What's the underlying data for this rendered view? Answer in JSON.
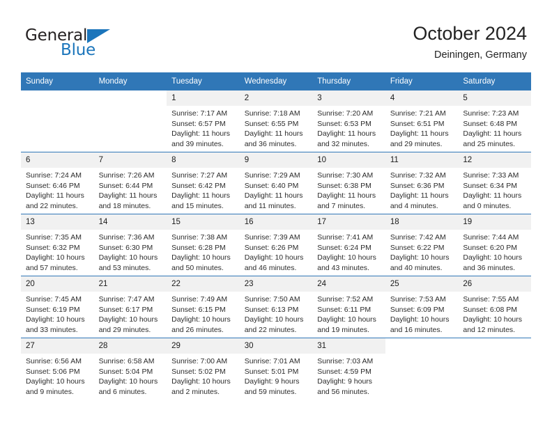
{
  "brand": {
    "name_dark": "General",
    "name_blue": "Blue",
    "accent_color": "#1b75bb"
  },
  "header": {
    "title": "October 2024",
    "subtitle": "Deiningen, Germany",
    "header_bar_color": "#3077b7",
    "day_band_color": "#f1f1f1"
  },
  "weekdays": [
    "Sunday",
    "Monday",
    "Tuesday",
    "Wednesday",
    "Thursday",
    "Friday",
    "Saturday"
  ],
  "labels": {
    "sunrise": "Sunrise:",
    "sunset": "Sunset:",
    "daylight": "Daylight:"
  },
  "weeks": [
    [
      {
        "day": "",
        "blank": true
      },
      {
        "day": "",
        "blank": true
      },
      {
        "day": "1",
        "sunrise": "Sunrise: 7:17 AM",
        "sunset": "Sunset: 6:57 PM",
        "daylight_1": "Daylight: 11 hours",
        "daylight_2": "and 39 minutes."
      },
      {
        "day": "2",
        "sunrise": "Sunrise: 7:18 AM",
        "sunset": "Sunset: 6:55 PM",
        "daylight_1": "Daylight: 11 hours",
        "daylight_2": "and 36 minutes."
      },
      {
        "day": "3",
        "sunrise": "Sunrise: 7:20 AM",
        "sunset": "Sunset: 6:53 PM",
        "daylight_1": "Daylight: 11 hours",
        "daylight_2": "and 32 minutes."
      },
      {
        "day": "4",
        "sunrise": "Sunrise: 7:21 AM",
        "sunset": "Sunset: 6:51 PM",
        "daylight_1": "Daylight: 11 hours",
        "daylight_2": "and 29 minutes."
      },
      {
        "day": "5",
        "sunrise": "Sunrise: 7:23 AM",
        "sunset": "Sunset: 6:48 PM",
        "daylight_1": "Daylight: 11 hours",
        "daylight_2": "and 25 minutes."
      }
    ],
    [
      {
        "day": "6",
        "sunrise": "Sunrise: 7:24 AM",
        "sunset": "Sunset: 6:46 PM",
        "daylight_1": "Daylight: 11 hours",
        "daylight_2": "and 22 minutes."
      },
      {
        "day": "7",
        "sunrise": "Sunrise: 7:26 AM",
        "sunset": "Sunset: 6:44 PM",
        "daylight_1": "Daylight: 11 hours",
        "daylight_2": "and 18 minutes."
      },
      {
        "day": "8",
        "sunrise": "Sunrise: 7:27 AM",
        "sunset": "Sunset: 6:42 PM",
        "daylight_1": "Daylight: 11 hours",
        "daylight_2": "and 15 minutes."
      },
      {
        "day": "9",
        "sunrise": "Sunrise: 7:29 AM",
        "sunset": "Sunset: 6:40 PM",
        "daylight_1": "Daylight: 11 hours",
        "daylight_2": "and 11 minutes."
      },
      {
        "day": "10",
        "sunrise": "Sunrise: 7:30 AM",
        "sunset": "Sunset: 6:38 PM",
        "daylight_1": "Daylight: 11 hours",
        "daylight_2": "and 7 minutes."
      },
      {
        "day": "11",
        "sunrise": "Sunrise: 7:32 AM",
        "sunset": "Sunset: 6:36 PM",
        "daylight_1": "Daylight: 11 hours",
        "daylight_2": "and 4 minutes."
      },
      {
        "day": "12",
        "sunrise": "Sunrise: 7:33 AM",
        "sunset": "Sunset: 6:34 PM",
        "daylight_1": "Daylight: 11 hours",
        "daylight_2": "and 0 minutes."
      }
    ],
    [
      {
        "day": "13",
        "sunrise": "Sunrise: 7:35 AM",
        "sunset": "Sunset: 6:32 PM",
        "daylight_1": "Daylight: 10 hours",
        "daylight_2": "and 57 minutes."
      },
      {
        "day": "14",
        "sunrise": "Sunrise: 7:36 AM",
        "sunset": "Sunset: 6:30 PM",
        "daylight_1": "Daylight: 10 hours",
        "daylight_2": "and 53 minutes."
      },
      {
        "day": "15",
        "sunrise": "Sunrise: 7:38 AM",
        "sunset": "Sunset: 6:28 PM",
        "daylight_1": "Daylight: 10 hours",
        "daylight_2": "and 50 minutes."
      },
      {
        "day": "16",
        "sunrise": "Sunrise: 7:39 AM",
        "sunset": "Sunset: 6:26 PM",
        "daylight_1": "Daylight: 10 hours",
        "daylight_2": "and 46 minutes."
      },
      {
        "day": "17",
        "sunrise": "Sunrise: 7:41 AM",
        "sunset": "Sunset: 6:24 PM",
        "daylight_1": "Daylight: 10 hours",
        "daylight_2": "and 43 minutes."
      },
      {
        "day": "18",
        "sunrise": "Sunrise: 7:42 AM",
        "sunset": "Sunset: 6:22 PM",
        "daylight_1": "Daylight: 10 hours",
        "daylight_2": "and 40 minutes."
      },
      {
        "day": "19",
        "sunrise": "Sunrise: 7:44 AM",
        "sunset": "Sunset: 6:20 PM",
        "daylight_1": "Daylight: 10 hours",
        "daylight_2": "and 36 minutes."
      }
    ],
    [
      {
        "day": "20",
        "sunrise": "Sunrise: 7:45 AM",
        "sunset": "Sunset: 6:19 PM",
        "daylight_1": "Daylight: 10 hours",
        "daylight_2": "and 33 minutes."
      },
      {
        "day": "21",
        "sunrise": "Sunrise: 7:47 AM",
        "sunset": "Sunset: 6:17 PM",
        "daylight_1": "Daylight: 10 hours",
        "daylight_2": "and 29 minutes."
      },
      {
        "day": "22",
        "sunrise": "Sunrise: 7:49 AM",
        "sunset": "Sunset: 6:15 PM",
        "daylight_1": "Daylight: 10 hours",
        "daylight_2": "and 26 minutes."
      },
      {
        "day": "23",
        "sunrise": "Sunrise: 7:50 AM",
        "sunset": "Sunset: 6:13 PM",
        "daylight_1": "Daylight: 10 hours",
        "daylight_2": "and 22 minutes."
      },
      {
        "day": "24",
        "sunrise": "Sunrise: 7:52 AM",
        "sunset": "Sunset: 6:11 PM",
        "daylight_1": "Daylight: 10 hours",
        "daylight_2": "and 19 minutes."
      },
      {
        "day": "25",
        "sunrise": "Sunrise: 7:53 AM",
        "sunset": "Sunset: 6:09 PM",
        "daylight_1": "Daylight: 10 hours",
        "daylight_2": "and 16 minutes."
      },
      {
        "day": "26",
        "sunrise": "Sunrise: 7:55 AM",
        "sunset": "Sunset: 6:08 PM",
        "daylight_1": "Daylight: 10 hours",
        "daylight_2": "and 12 minutes."
      }
    ],
    [
      {
        "day": "27",
        "sunrise": "Sunrise: 6:56 AM",
        "sunset": "Sunset: 5:06 PM",
        "daylight_1": "Daylight: 10 hours",
        "daylight_2": "and 9 minutes."
      },
      {
        "day": "28",
        "sunrise": "Sunrise: 6:58 AM",
        "sunset": "Sunset: 5:04 PM",
        "daylight_1": "Daylight: 10 hours",
        "daylight_2": "and 6 minutes."
      },
      {
        "day": "29",
        "sunrise": "Sunrise: 7:00 AM",
        "sunset": "Sunset: 5:02 PM",
        "daylight_1": "Daylight: 10 hours",
        "daylight_2": "and 2 minutes."
      },
      {
        "day": "30",
        "sunrise": "Sunrise: 7:01 AM",
        "sunset": "Sunset: 5:01 PM",
        "daylight_1": "Daylight: 9 hours",
        "daylight_2": "and 59 minutes."
      },
      {
        "day": "31",
        "sunrise": "Sunrise: 7:03 AM",
        "sunset": "Sunset: 4:59 PM",
        "daylight_1": "Daylight: 9 hours",
        "daylight_2": "and 56 minutes."
      },
      {
        "day": "",
        "blank": true
      },
      {
        "day": "",
        "blank": true
      }
    ]
  ]
}
